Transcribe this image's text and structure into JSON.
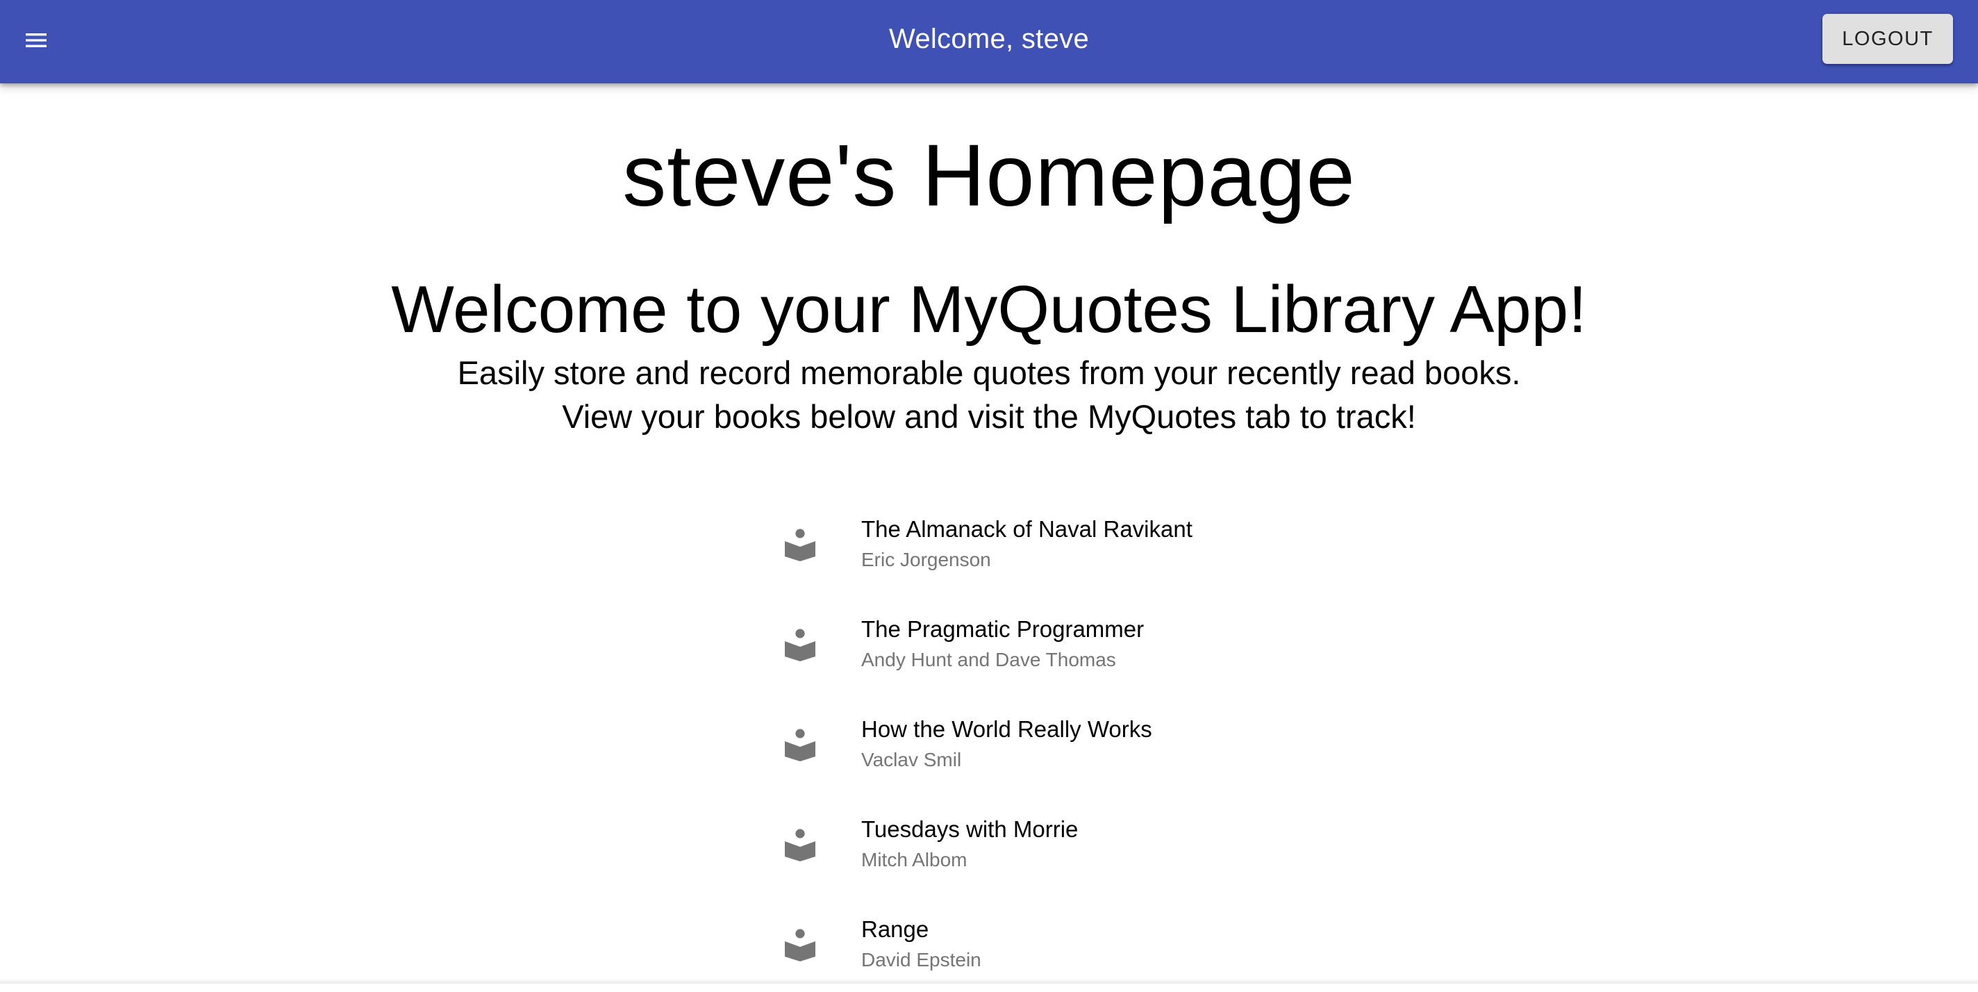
{
  "appbar": {
    "title": "Welcome, steve",
    "logout_label": "LOGOUT",
    "background_color": "#3f51b5",
    "menu_icon": "hamburger-menu-icon"
  },
  "main": {
    "page_title": "steve's Homepage",
    "welcome_heading": "Welcome to your MyQuotes Library App!",
    "subtitle_line1": "Easily store and record memorable quotes from your recently read books.",
    "subtitle_line2": "View your books below and visit the MyQuotes tab to track!"
  },
  "books": [
    {
      "title": "The Almanack of Naval Ravikant",
      "author": "Eric Jorgenson",
      "icon": "book-reader-icon"
    },
    {
      "title": "The Pragmatic Programmer",
      "author": "Andy Hunt and Dave Thomas",
      "icon": "book-reader-icon"
    },
    {
      "title": "How the World Really Works",
      "author": "Vaclav Smil",
      "icon": "book-reader-icon"
    },
    {
      "title": "Tuesdays with Morrie",
      "author": "Mitch Albom",
      "icon": "book-reader-icon"
    },
    {
      "title": "Range",
      "author": "David Epstein",
      "icon": "book-reader-icon"
    }
  ]
}
